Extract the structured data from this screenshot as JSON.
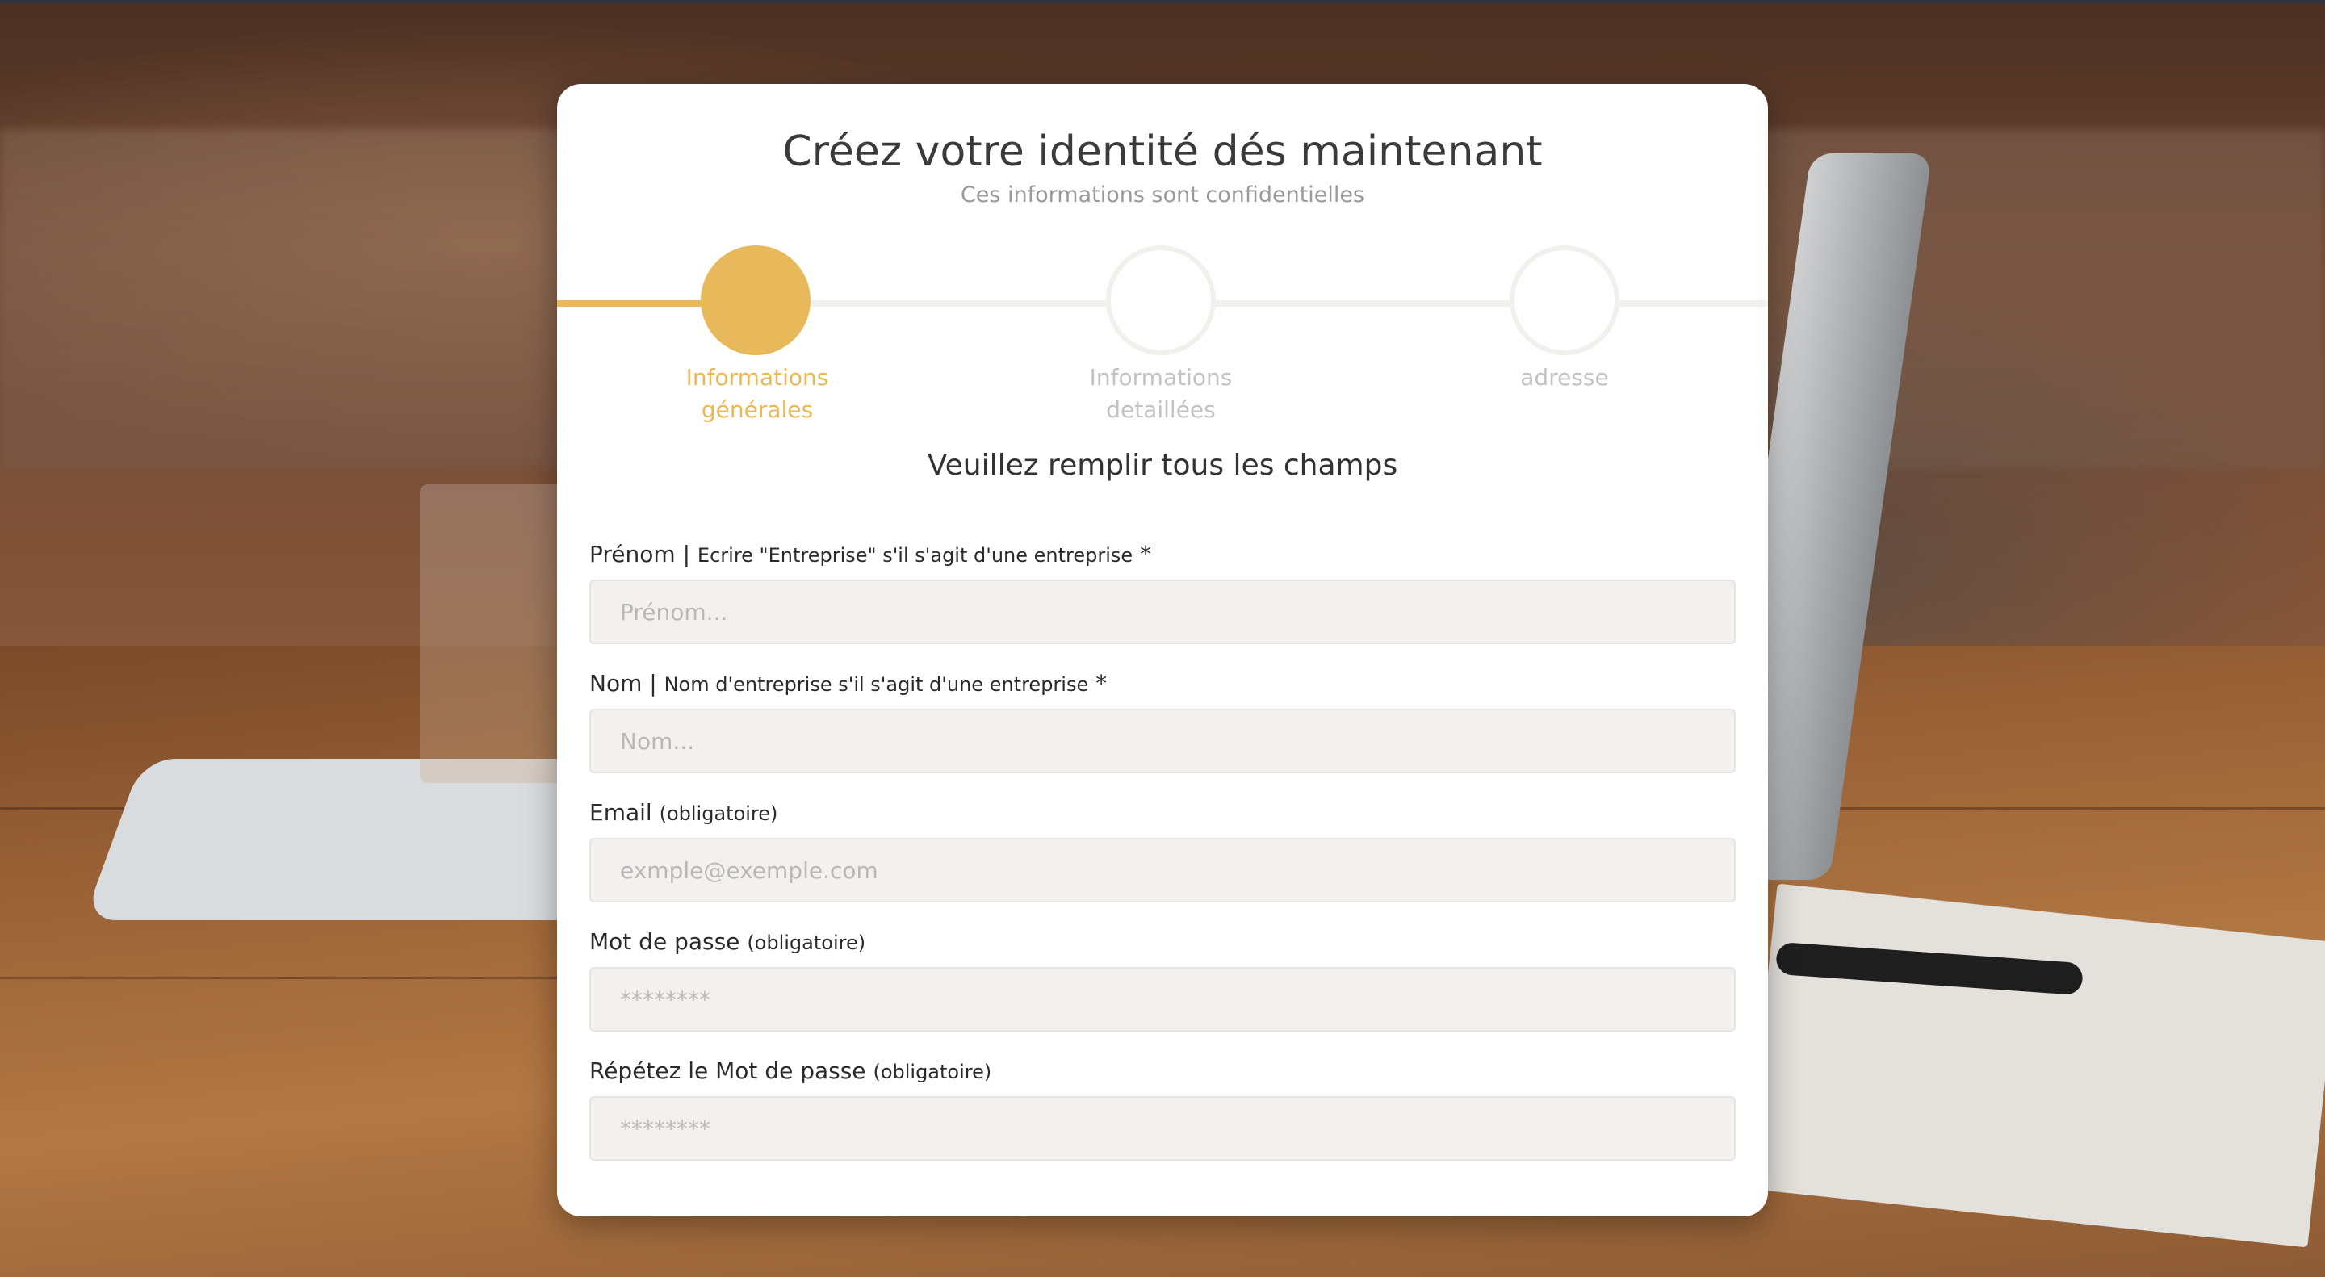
{
  "header": {
    "title": "Créez votre identité dés maintenant",
    "subtitle": "Ces informations sont confidentielles"
  },
  "progress": {
    "fraction": 0.17,
    "accent_color": "#e8b95a"
  },
  "steps": [
    {
      "label_line1": "Informations",
      "label_line2": "générales",
      "state": "active"
    },
    {
      "label_line1": "Informations",
      "label_line2": "detaillées",
      "state": "inactive"
    },
    {
      "label_line1": "adresse",
      "label_line2": "",
      "state": "inactive"
    }
  ],
  "instruction": "Veuillez remplir tous les champs",
  "fields": {
    "firstname": {
      "label": "Prénom |",
      "hint": "Ecrire \"Entreprise\" s'il s'agit d'une entreprise",
      "required_mark": "*",
      "placeholder": "Prénom..."
    },
    "lastname": {
      "label": "Nom |",
      "hint": "Nom d'entreprise s'il s'agit d'une entreprise",
      "required_mark": "*",
      "placeholder": "Nom..."
    },
    "email": {
      "label": "Email",
      "hint": "(obligatoire)",
      "placeholder": "exmple@exemple.com"
    },
    "password": {
      "label": "Mot de passe",
      "hint": "(obligatoire)",
      "placeholder": "********"
    },
    "password_confirm": {
      "label": "Répétez le Mot de passe",
      "hint": "(obligatoire)",
      "placeholder": "********"
    }
  }
}
